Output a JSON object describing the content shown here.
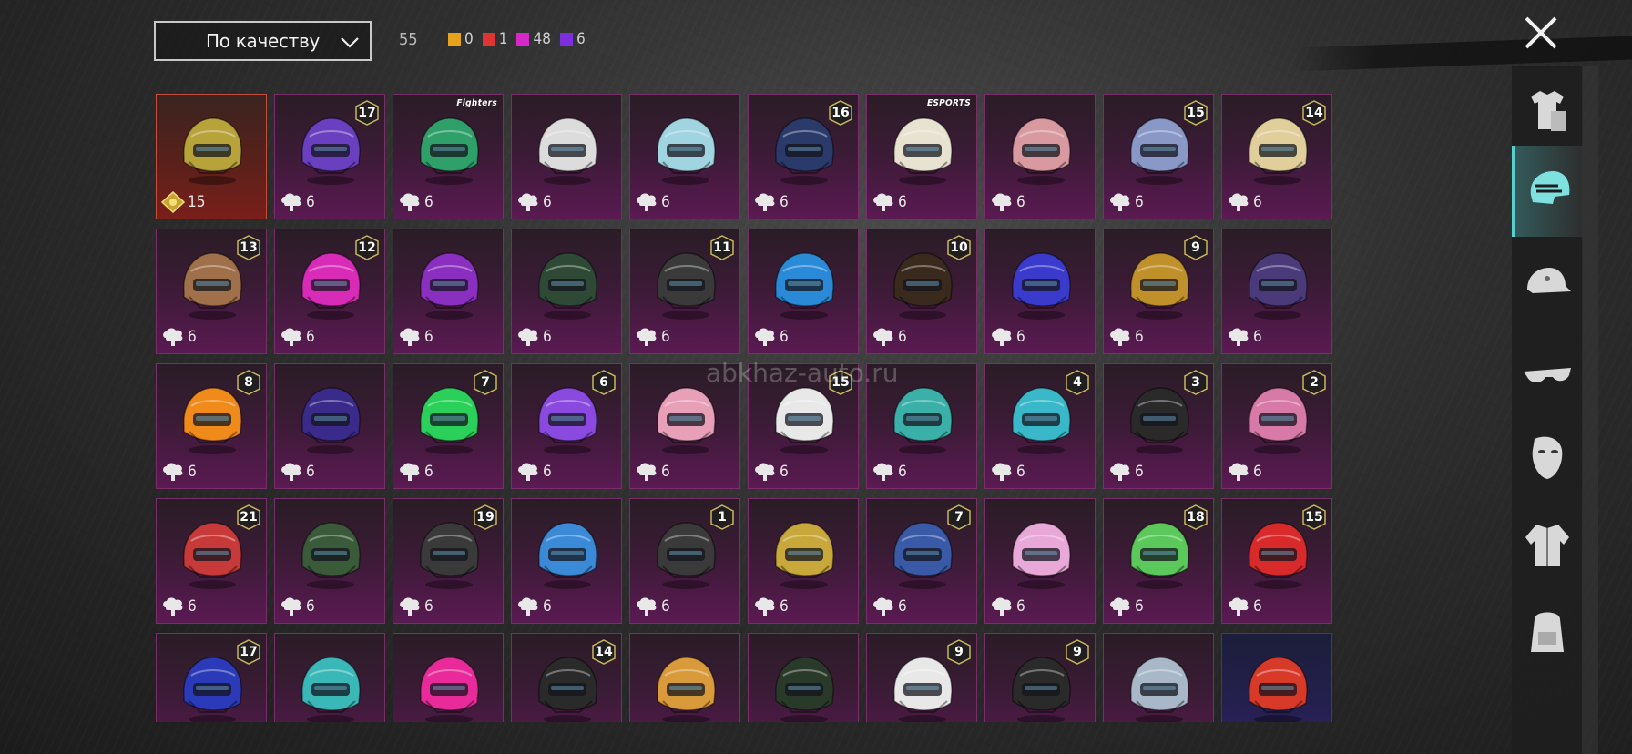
{
  "header": {
    "sort_label": "По качеству",
    "total_count": "55",
    "legend": [
      {
        "color": "#e6a21a",
        "count": "0"
      },
      {
        "color": "#e23232",
        "count": "1"
      },
      {
        "color": "#d628c8",
        "count": "48"
      },
      {
        "color": "#7d2ee0",
        "count": "6"
      }
    ]
  },
  "watermark": "abkhaz-auto.ru",
  "items": [
    {
      "badge": "",
      "cost": "15",
      "rarity": "gold",
      "color": "#b8a23a",
      "brand": ""
    },
    {
      "badge": "17",
      "cost": "6",
      "rarity": "purple",
      "color": "#6a3fc0",
      "brand": ""
    },
    {
      "badge": "",
      "cost": "6",
      "rarity": "purple",
      "color": "#2fa06a",
      "brand": "Fighters"
    },
    {
      "badge": "",
      "cost": "6",
      "rarity": "purple",
      "color": "#dcdcdc",
      "brand": ""
    },
    {
      "badge": "",
      "cost": "6",
      "rarity": "purple",
      "color": "#9fd4e0",
      "brand": ""
    },
    {
      "badge": "16",
      "cost": "6",
      "rarity": "purple",
      "color": "#2a3a6a",
      "brand": ""
    },
    {
      "badge": "",
      "cost": "6",
      "rarity": "purple",
      "color": "#e8e2d0",
      "brand": "ESPORTS"
    },
    {
      "badge": "",
      "cost": "6",
      "rarity": "purple",
      "color": "#d89aa0",
      "brand": ""
    },
    {
      "badge": "15",
      "cost": "6",
      "rarity": "purple",
      "color": "#8a98c8",
      "brand": ""
    },
    {
      "badge": "14",
      "cost": "6",
      "rarity": "purple",
      "color": "#e0cf9a",
      "brand": ""
    },
    {
      "badge": "13",
      "cost": "6",
      "rarity": "purple",
      "color": "#a0704a",
      "brand": ""
    },
    {
      "badge": "12",
      "cost": "6",
      "rarity": "purple",
      "color": "#d82cb8",
      "brand": ""
    },
    {
      "badge": "",
      "cost": "6",
      "rarity": "purple",
      "color": "#8a2fc0",
      "brand": ""
    },
    {
      "badge": "",
      "cost": "6",
      "rarity": "purple",
      "color": "#2e4a36",
      "brand": ""
    },
    {
      "badge": "11",
      "cost": "6",
      "rarity": "purple",
      "color": "#3a3a3a",
      "brand": ""
    },
    {
      "badge": "",
      "cost": "6",
      "rarity": "purple",
      "color": "#2a8ad8",
      "brand": ""
    },
    {
      "badge": "10",
      "cost": "6",
      "rarity": "purple",
      "color": "#3a2a1e",
      "brand": ""
    },
    {
      "badge": "",
      "cost": "6",
      "rarity": "purple",
      "color": "#3a3acc",
      "brand": ""
    },
    {
      "badge": "9",
      "cost": "6",
      "rarity": "purple",
      "color": "#c0902a",
      "brand": ""
    },
    {
      "badge": "",
      "cost": "6",
      "rarity": "purple",
      "color": "#4a3a7a",
      "brand": ""
    },
    {
      "badge": "8",
      "cost": "6",
      "rarity": "purple",
      "color": "#f08a1a",
      "brand": ""
    },
    {
      "badge": "",
      "cost": "6",
      "rarity": "purple",
      "color": "#3a2a8a",
      "brand": ""
    },
    {
      "badge": "7",
      "cost": "6",
      "rarity": "purple",
      "color": "#2ad05a",
      "brand": ""
    },
    {
      "badge": "6",
      "cost": "6",
      "rarity": "purple",
      "color": "#8a4ae0",
      "brand": ""
    },
    {
      "badge": "",
      "cost": "6",
      "rarity": "purple",
      "color": "#e8a0b8",
      "brand": ""
    },
    {
      "badge": "15",
      "cost": "6",
      "rarity": "purple",
      "color": "#e8e8e8",
      "brand": ""
    },
    {
      "badge": "",
      "cost": "6",
      "rarity": "purple",
      "color": "#3ab0a8",
      "brand": ""
    },
    {
      "badge": "4",
      "cost": "6",
      "rarity": "purple",
      "color": "#38b8c8",
      "brand": ""
    },
    {
      "badge": "3",
      "cost": "6",
      "rarity": "purple",
      "color": "#2a2a2a",
      "brand": ""
    },
    {
      "badge": "2",
      "cost": "6",
      "rarity": "purple",
      "color": "#d87aa8",
      "brand": ""
    },
    {
      "badge": "21",
      "cost": "6",
      "rarity": "purple",
      "color": "#c83a3a",
      "brand": ""
    },
    {
      "badge": "",
      "cost": "6",
      "rarity": "purple",
      "color": "#3a5a3a",
      "brand": ""
    },
    {
      "badge": "19",
      "cost": "6",
      "rarity": "purple",
      "color": "#3a3a3a",
      "brand": ""
    },
    {
      "badge": "",
      "cost": "6",
      "rarity": "purple",
      "color": "#3a8ad8",
      "brand": ""
    },
    {
      "badge": "1",
      "cost": "6",
      "rarity": "purple",
      "color": "#3a3a3a",
      "brand": ""
    },
    {
      "badge": "",
      "cost": "6",
      "rarity": "purple",
      "color": "#c8a83a",
      "brand": ""
    },
    {
      "badge": "7",
      "cost": "6",
      "rarity": "purple",
      "color": "#3a5aa8",
      "brand": ""
    },
    {
      "badge": "",
      "cost": "6",
      "rarity": "purple",
      "color": "#e8a8d8",
      "brand": ""
    },
    {
      "badge": "18",
      "cost": "6",
      "rarity": "purple",
      "color": "#5ac85a",
      "brand": ""
    },
    {
      "badge": "15",
      "cost": "6",
      "rarity": "purple",
      "color": "#d82a2a",
      "brand": ""
    },
    {
      "badge": "17",
      "cost": "",
      "rarity": "purple",
      "color": "#2a3ab8",
      "brand": ""
    },
    {
      "badge": "",
      "cost": "",
      "rarity": "purple",
      "color": "#3ab8b8",
      "brand": ""
    },
    {
      "badge": "",
      "cost": "",
      "rarity": "purple",
      "color": "#e82a9a",
      "brand": ""
    },
    {
      "badge": "14",
      "cost": "",
      "rarity": "purple",
      "color": "#2a2a2a",
      "brand": ""
    },
    {
      "badge": "",
      "cost": "",
      "rarity": "purple",
      "color": "#d89a3a",
      "brand": ""
    },
    {
      "badge": "",
      "cost": "",
      "rarity": "purple",
      "color": "#2a3a2a",
      "brand": ""
    },
    {
      "badge": "9",
      "cost": "",
      "rarity": "purple",
      "color": "#e8e8e8",
      "brand": ""
    },
    {
      "badge": "9",
      "cost": "",
      "rarity": "purple",
      "color": "#2a2a2a",
      "brand": ""
    },
    {
      "badge": "",
      "cost": "",
      "rarity": "purple",
      "color": "#a8b8c8",
      "brand": ""
    },
    {
      "badge": "",
      "cost": "",
      "rarity": "violet",
      "color": "#d83a2a",
      "brand": ""
    }
  ],
  "sidebar": [
    {
      "icon": "outfit-icon"
    },
    {
      "icon": "helmet-icon",
      "active": true
    },
    {
      "icon": "cap-icon"
    },
    {
      "icon": "glasses-icon"
    },
    {
      "icon": "mask-icon"
    },
    {
      "icon": "jacket-icon"
    },
    {
      "icon": "backpack-icon"
    }
  ]
}
